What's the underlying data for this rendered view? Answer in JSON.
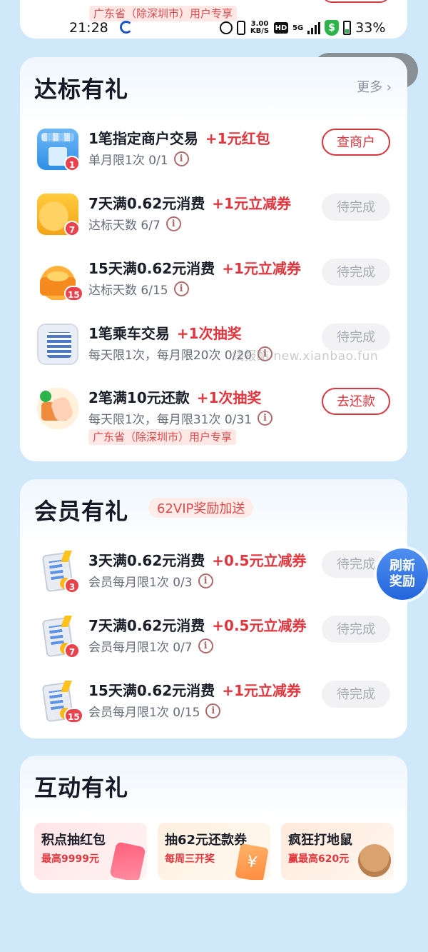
{
  "top_card": {
    "region_tag": "广东省（除深圳市）用户专享"
  },
  "status_bar": {
    "time": "21:28",
    "speed_value": "3.00",
    "speed_unit": "KB/S",
    "hd": "HD",
    "network": "5G",
    "battery": "33%",
    "icons": [
      "alarm-icon",
      "vibrate-icon",
      "signal-icon",
      "shield-icon",
      "battery-icon"
    ]
  },
  "capsule": {
    "menu_glyph": "•••",
    "close_glyph": "✕"
  },
  "section1": {
    "title": "达标有礼",
    "more": "更多 ›",
    "tasks": [
      {
        "title": "1笔指定商户交易",
        "reward": "+1元红包",
        "sub": "单月限1次  0/1",
        "badge": "1",
        "button": "查商户",
        "button_state": "active",
        "icon": "shop-icon"
      },
      {
        "title": "7天满0.62元消费",
        "reward": "+1元立减券",
        "sub": "达标天数  6/7",
        "badge": "7",
        "button": "待完成",
        "button_state": "disabled",
        "icon": "coins-icon"
      },
      {
        "title": "15天满0.62元消费",
        "reward": "+1元立减券",
        "sub": "达标天数  6/15",
        "badge": "15",
        "button": "待完成",
        "button_state": "disabled",
        "icon": "gift-box-icon"
      },
      {
        "title": "1笔乘车交易",
        "reward": "+1次抽奖",
        "sub": "每天限1次，每月限20次  0/20",
        "badge": "",
        "button": "待完成",
        "button_state": "disabled",
        "icon": "qr-code-icon"
      },
      {
        "title": "2笔满10元还款",
        "reward": "+1次抽奖",
        "sub": "每天限1次，每月限31次  0/31",
        "badge": "",
        "button": "去还款",
        "button_state": "active",
        "icon": "card-payment-icon",
        "tag": "广东省（除深圳市）用户专享"
      }
    ]
  },
  "watermark": "线报酷 new.xianbao.fun",
  "section2": {
    "title": "会员有礼",
    "vip_tag": "62VIP奖励加送",
    "tasks": [
      {
        "title": "3天满0.62元消费",
        "reward": "+0.5元立减券",
        "sub": "会员每月限1次  0/3",
        "badge": "3",
        "button": "待完成",
        "icon": "receipt-icon"
      },
      {
        "title": "7天满0.62元消费",
        "reward": "+0.5元立减券",
        "sub": "会员每月限1次  0/7",
        "badge": "7",
        "button": "待完成",
        "icon": "receipt-icon"
      },
      {
        "title": "15天满0.62元消费",
        "reward": "+1元立减券",
        "sub": "会员每月限1次  0/15",
        "badge": "15",
        "button": "待完成",
        "icon": "receipt-icon"
      }
    ]
  },
  "refresh": {
    "line1": "刷新",
    "line2": "奖励"
  },
  "section3": {
    "title": "互动有礼",
    "tiles": [
      {
        "title": "积点抽红包",
        "sub": "最高9999元",
        "icon": "red-packet-icon"
      },
      {
        "title": "抽62元还款券",
        "sub": "每周三开奖",
        "icon": "ticket-icon",
        "glyph": "¥"
      },
      {
        "title": "疯狂打地鼠",
        "sub": "赢最高620元",
        "icon": "mole-icon"
      }
    ]
  },
  "colors": {
    "accent_red": "#e0373f",
    "background": "#cfe9fb",
    "refresh_blue": "#2466db"
  }
}
